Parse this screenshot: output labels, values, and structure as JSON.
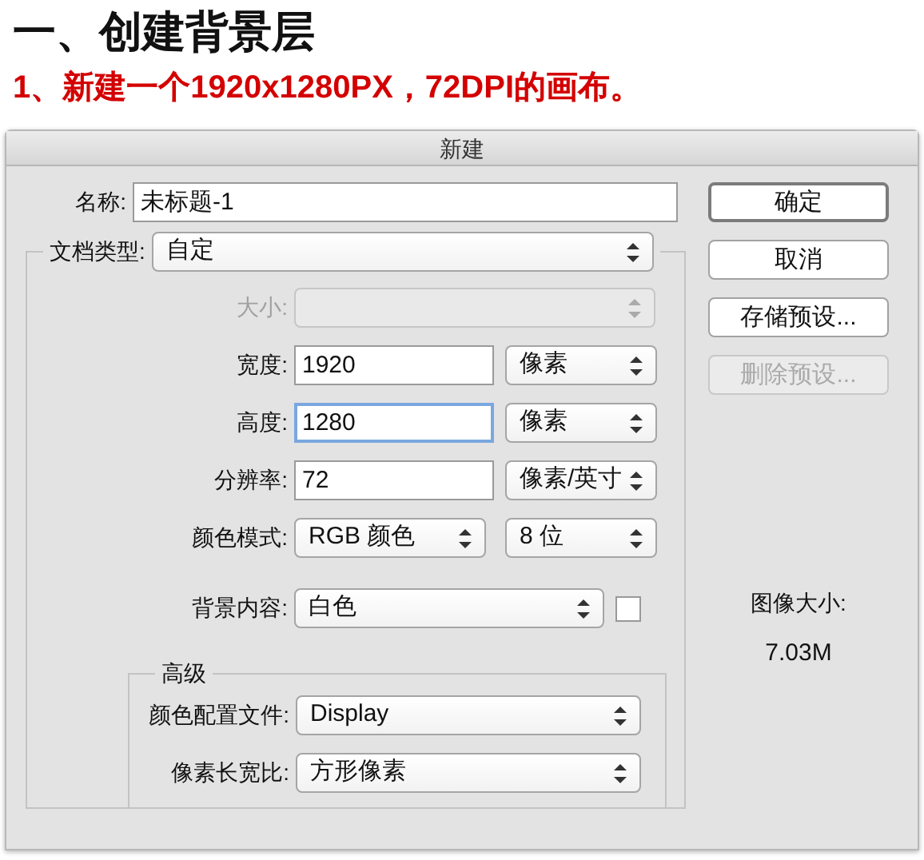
{
  "heading": "一、创建背景层",
  "step": "1、新建一个1920x1280PX，72DPI的画布。",
  "dialog": {
    "title": "新建",
    "name": {
      "label": "名称:",
      "value": "未标题-1"
    },
    "preset": {
      "label": "文档类型:",
      "value": "自定"
    },
    "fields": [
      {
        "kind": "select",
        "label": "大小:",
        "disabled": true
      },
      {
        "kind": "number",
        "label": "宽度:",
        "value": "1920",
        "unit": "像素",
        "focused": false
      },
      {
        "kind": "number",
        "label": "高度:",
        "value": "1280",
        "unit": "像素",
        "focused": true
      },
      {
        "kind": "number",
        "label": "分辨率:",
        "value": "72",
        "unit": "像素/英寸",
        "focused": false
      },
      {
        "kind": "pair",
        "label": "颜色模式:",
        "value": "RGB 颜色",
        "unit": "8 位"
      },
      {
        "kind": "swatch",
        "label": "背景内容:",
        "value": "白色",
        "color": "#ffffff"
      }
    ],
    "advanced": {
      "title": "高级",
      "fields": [
        {
          "label": "颜色配置文件:",
          "value": "Display"
        },
        {
          "label": "像素长宽比:",
          "value": "方形像素"
        }
      ]
    },
    "buttons": [
      {
        "label": "确定",
        "default": true,
        "disabled": false
      },
      {
        "label": "取消",
        "default": false,
        "disabled": false
      },
      {
        "label": "存储预设...",
        "default": false,
        "disabled": false
      },
      {
        "label": "删除预设...",
        "default": false,
        "disabled": true
      }
    ],
    "image_size": {
      "label": "图像大小:",
      "value": "7.03M"
    }
  }
}
